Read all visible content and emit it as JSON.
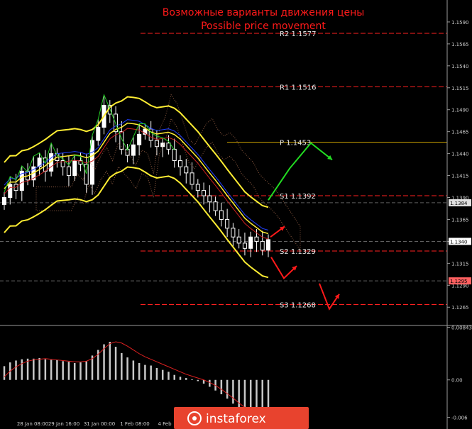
{
  "header": {
    "title_ru": "Возможные варианты движения цены",
    "title_en": "Possible price movement",
    "title_color": "#ff1a1a"
  },
  "chart_data": [
    {
      "type": "candlestick",
      "subtitle": "",
      "ylim": [
        1.1245,
        1.1615
      ],
      "y_ticks": [
        1.159,
        1.1565,
        1.154,
        1.1515,
        1.149,
        1.1465,
        1.144,
        1.1415,
        1.139,
        1.1365,
        1.134,
        1.1315,
        1.129,
        1.1265
      ],
      "y_tick_labels": [
        "1.1590",
        "1.1565",
        "1.1540",
        "1.1515",
        "1.1490",
        "1.1465",
        "1.1440",
        "1.1415",
        "1.1390",
        "1.1365",
        "1.1340",
        "1.1315",
        "1.1290",
        "1.1265"
      ],
      "price_tags": [
        {
          "label": "1.1384",
          "value": 1.1384,
          "color": "#e0e0e0"
        },
        {
          "label": "1.1340",
          "value": 1.134,
          "color": "#ffffff"
        },
        {
          "label": "1.1295",
          "value": 1.1295,
          "color": "#ff6060"
        }
      ],
      "pivot_levels": [
        {
          "label": "R2  1.1577",
          "value": 1.1577,
          "color": "#ff2020"
        },
        {
          "label": "R1  1.1516",
          "value": 1.1516,
          "color": "#ff2020"
        },
        {
          "label": "P  1.1453",
          "value": 1.1453,
          "color": "#c8a000"
        },
        {
          "label": "S1  1.1392",
          "value": 1.1392,
          "color": "#ff2020"
        },
        {
          "label": "S2  1.1329",
          "value": 1.1329,
          "color": "#ff2020"
        },
        {
          "label": "S3  1.1268",
          "value": 1.1268,
          "color": "#ff2020"
        }
      ],
      "close_path": [
        1.139,
        1.1405,
        1.1398,
        1.142,
        1.141,
        1.1425,
        1.1435,
        1.142,
        1.144,
        1.1432,
        1.1425,
        1.1415,
        1.1432,
        1.1428,
        1.1405,
        1.1455,
        1.147,
        1.1495,
        1.1485,
        1.1465,
        1.1445,
        1.1438,
        1.145,
        1.1462,
        1.1468,
        1.1455,
        1.1448,
        1.1452,
        1.1445,
        1.1432,
        1.1425,
        1.1418,
        1.1405,
        1.1398,
        1.1392,
        1.1385,
        1.1375,
        1.1365,
        1.1355,
        1.1345,
        1.1338,
        1.1332,
        1.1345,
        1.134,
        1.133,
        1.1342
      ],
      "forecast_paths": [
        {
          "color": "#22dd22",
          "points": [
            [
              1.1387
            ],
            [
              1.1423
            ],
            [
              1.1452
            ],
            [
              1.1433
            ]
          ]
        },
        {
          "color": "#ff1a1a",
          "points": [
            [
              1.1345
            ],
            [
              1.1357
            ]
          ]
        },
        {
          "color": "#ff1a1a",
          "points": [
            [
              1.1322
            ],
            [
              1.1298
            ],
            [
              1.1312
            ]
          ]
        },
        {
          "color": "#ff1a1a",
          "points": [
            [
              1.1292
            ],
            [
              1.1263
            ],
            [
              1.128
            ]
          ]
        }
      ]
    },
    {
      "type": "bar",
      "title": "",
      "ylim": [
        -0.0065,
        0.0086
      ],
      "y_tick_labels": [
        "0.00843",
        "0.00",
        "-0.006"
      ],
      "y_ticks": [
        0.00843,
        0.0,
        -0.006
      ],
      "x_tick_labels": [
        "28 Jan 08:00",
        "29 Jan 16:00",
        "31 Jan 00:00",
        "1 Feb 08:00",
        "4 Feb"
      ],
      "histogram": [
        0.0022,
        0.0028,
        0.0031,
        0.0033,
        0.0034,
        0.0034,
        0.0035,
        0.0033,
        0.0032,
        0.0032,
        0.003,
        0.0029,
        0.0027,
        0.0028,
        0.003,
        0.0039,
        0.0048,
        0.0057,
        0.0061,
        0.0053,
        0.0043,
        0.0036,
        0.0031,
        0.0027,
        0.0024,
        0.0023,
        0.0019,
        0.0016,
        0.0013,
        0.0008,
        0.0005,
        0.0003,
        0.0001,
        -0.0002,
        -0.0006,
        -0.0011,
        -0.0017,
        -0.0023,
        -0.003,
        -0.0038,
        -0.0045,
        -0.0051,
        -0.0055,
        -0.0057,
        -0.0058,
        -0.0057
      ],
      "signal": [
        0.0005,
        0.0014,
        0.0021,
        0.0026,
        0.003,
        0.0032,
        0.0033,
        0.0034,
        0.0033,
        0.0032,
        0.0031,
        0.003,
        0.0029,
        0.0029,
        0.003,
        0.0034,
        0.0041,
        0.005,
        0.0058,
        0.0061,
        0.0059,
        0.0054,
        0.0048,
        0.0042,
        0.0037,
        0.0033,
        0.0029,
        0.0025,
        0.0021,
        0.0017,
        0.0013,
        0.0009,
        0.0006,
        0.0003,
        0.0,
        -0.0004,
        -0.0009,
        -0.0015,
        -0.0022,
        -0.0029,
        -0.0037,
        -0.0044,
        -0.005,
        -0.0054,
        -0.0057,
        -0.0058
      ]
    }
  ],
  "watermark": {
    "brand": "instaforex"
  }
}
